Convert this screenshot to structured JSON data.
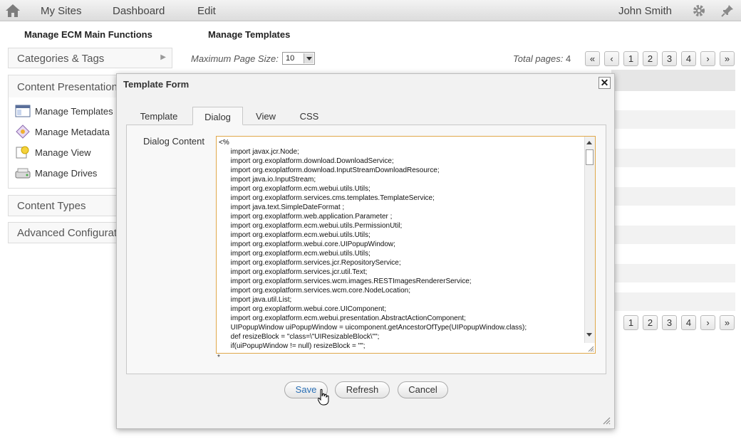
{
  "topbar": {
    "nav": [
      "My Sites",
      "Dashboard",
      "Edit"
    ],
    "user": "John Smith"
  },
  "sections": {
    "left_title": "Manage ECM Main Functions",
    "right_title": "Manage Templates"
  },
  "left_panel": {
    "categories": "Categories & Tags",
    "content_presentation": "Content Presentation",
    "items": [
      "Manage Templates",
      "Manage Metadata",
      "Manage View",
      "Manage Drives"
    ],
    "content_types": "Content Types",
    "advanced": "Advanced Configuration"
  },
  "toolbar": {
    "page_size_label": "Maximum Page Size:",
    "page_size_value": "10",
    "total_pages_label": "Total pages:",
    "total_pages_value": "4",
    "pager": [
      "«",
      "‹",
      "1",
      "2",
      "3",
      "4",
      "›",
      "»"
    ]
  },
  "modal": {
    "title": "Template Form",
    "close": "✕",
    "tabs": [
      "Template",
      "Dialog",
      "View",
      "CSS"
    ],
    "active_tab": "Dialog",
    "field_label": "Dialog Content",
    "code": "<%\n      import javax.jcr.Node;\n      import org.exoplatform.download.DownloadService;\n      import org.exoplatform.download.InputStreamDownloadResource;\n      import java.io.InputStream;\n      import org.exoplatform.ecm.webui.utils.Utils;\n      import org.exoplatform.services.cms.templates.TemplateService;\n      import java.text.SimpleDateFormat ;\n      import org.exoplatform.web.application.Parameter ;\n      import org.exoplatform.ecm.webui.utils.PermissionUtil;\n      import org.exoplatform.ecm.webui.utils.Utils;\n      import org.exoplatform.webui.core.UIPopupWindow;\n      import org.exoplatform.ecm.webui.utils.Utils;\n      import org.exoplatform.services.jcr.RepositoryService;\n      import org.exoplatform.services.jcr.util.Text;\n      import org.exoplatform.services.wcm.images.RESTImagesRendererService;\n      import org.exoplatform.services.wcm.core.NodeLocation;\n      import java.util.List;\n      import org.exoplatform.webui.core.UIComponent;\n      import org.exoplatform.ecm.webui.presentation.AbstractActionComponent;\n      UIPopupWindow uiPopupWindow = uicomponent.getAncestorOfType(UIPopupWindow.class);\n      def resizeBlock = \"class=\\\"UIResizableBlock\\\"\";\n      if(uiPopupWindow != null) resizeBlock = \"\";",
    "asterisk": "*",
    "buttons": {
      "save": "Save",
      "refresh": "Refresh",
      "cancel": "Cancel"
    }
  },
  "colors": {
    "accent_border": "#e0a84a",
    "link_blue": "#2a6fb5"
  }
}
